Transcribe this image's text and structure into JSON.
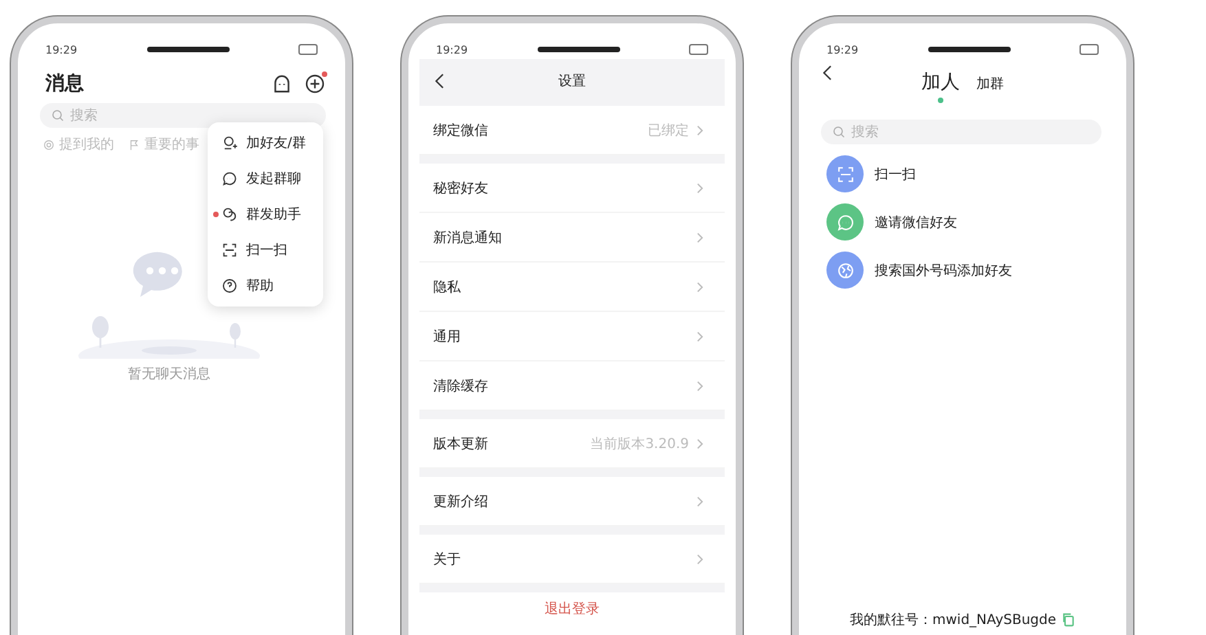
{
  "phones": [
    {
      "kind": "messages",
      "time": "19:29",
      "title": "消息",
      "plus_badge": true,
      "search": {
        "placeholder": "搜索"
      },
      "filters": [
        {
          "label": "提到我的"
        },
        {
          "label": "重要的事"
        }
      ],
      "menu": [
        {
          "label": "加好友/群",
          "dot": false
        },
        {
          "label": "发起群聊",
          "dot": false
        },
        {
          "label": "群发助手",
          "dot": true
        },
        {
          "label": "扫一扫",
          "dot": false
        },
        {
          "label": "帮助",
          "dot": false
        }
      ],
      "empty_text": "暂无聊天消息"
    },
    {
      "kind": "settings",
      "time": "19:29",
      "title": "设置",
      "groups": [
        [
          {
            "label": "绑定微信",
            "value": "已绑定"
          }
        ],
        [
          {
            "label": "秘密好友"
          },
          {
            "label": "新消息通知"
          },
          {
            "label": "隐私"
          },
          {
            "label": "通用"
          },
          {
            "label": "清除缓存"
          }
        ],
        [
          {
            "label": "版本更新",
            "value": "当前版本3.20.9"
          }
        ],
        [
          {
            "label": "更新介绍"
          }
        ],
        [
          {
            "label": "关于"
          }
        ]
      ],
      "logout": "退出登录"
    },
    {
      "kind": "add",
      "time": "19:29",
      "tabs": [
        {
          "label": "加人",
          "selected": true
        },
        {
          "label": "加群",
          "selected": false
        }
      ],
      "search": {
        "placeholder": "搜索"
      },
      "actions": [
        {
          "label": "扫一扫",
          "color": "#7d9ef2"
        },
        {
          "label": "邀请微信好友",
          "color": "#5cc485"
        },
        {
          "label": "搜索国外号码添加好友",
          "color": "#7d9ef2"
        }
      ],
      "footer": "我的默往号：mwid_NAySBugde"
    }
  ]
}
